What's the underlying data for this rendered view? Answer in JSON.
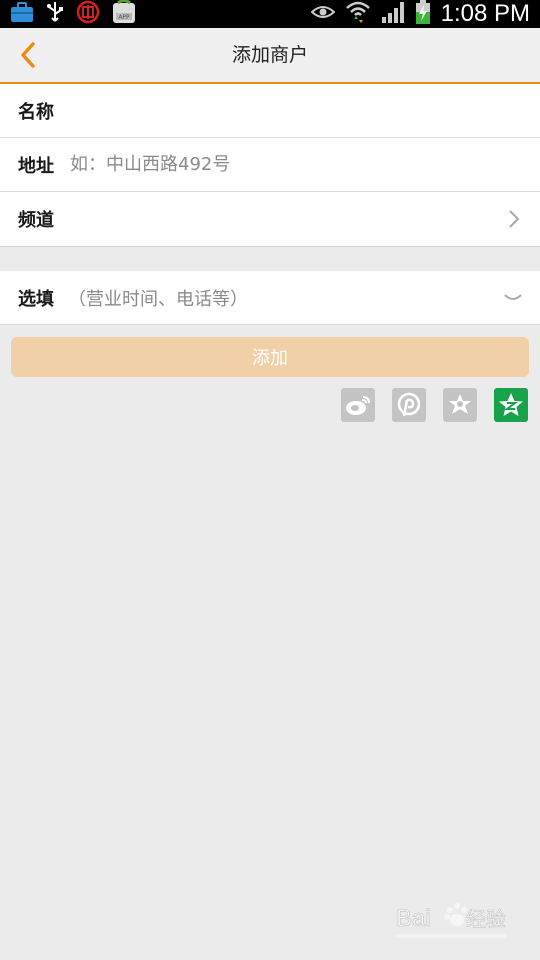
{
  "status_bar": {
    "time": "1:08 PM",
    "icons": [
      "briefcase-icon",
      "usb-icon",
      "bank-icon",
      "app-store-icon",
      "eye-icon",
      "wifi-icon",
      "signal-icon",
      "battery-charging-icon"
    ]
  },
  "header": {
    "title": "添加商户",
    "accent_color": "#f08a14"
  },
  "form": {
    "name_label": "名称",
    "name_value": "",
    "address_label": "地址",
    "address_placeholder": "如：中山西路492号",
    "channel_label": "频道",
    "optional_label": "选填",
    "optional_hint": "（营业时间、电话等）"
  },
  "add_button": {
    "label": "添加",
    "color": "#f2d0a7"
  },
  "share_icons": [
    "weibo-icon",
    "pinterest-icon",
    "flower-icon",
    "qzone-icon"
  ],
  "watermark": {
    "text": "Bai经验"
  }
}
